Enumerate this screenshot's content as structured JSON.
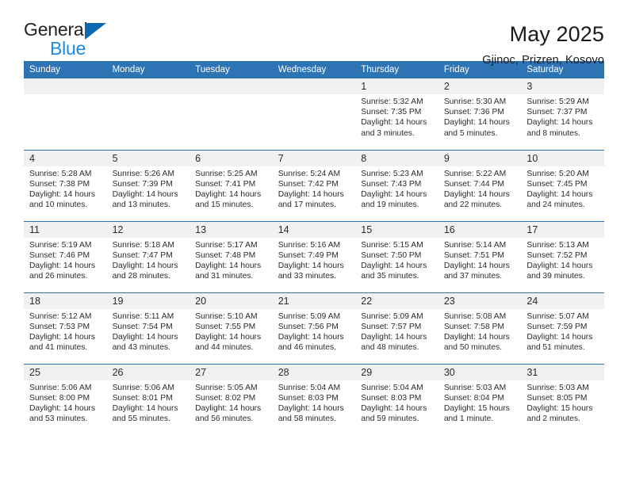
{
  "logo": {
    "word_top": "General",
    "word_bottom": "Blue",
    "triangle_color": "#0b68b1",
    "blue_text_color": "#1f8ae0"
  },
  "header": {
    "title": "May 2025",
    "subtitle": "Gjinoc, Prizren, Kosovo"
  },
  "theme": {
    "header_blue": "#2e74b5",
    "daynum_band": "#f1f1f1",
    "text": "#2b2b2b"
  },
  "calendar": {
    "weekday_headers": [
      "Sunday",
      "Monday",
      "Tuesday",
      "Wednesday",
      "Thursday",
      "Friday",
      "Saturday"
    ],
    "labels": {
      "sunrise": "Sunrise:",
      "sunset": "Sunset:",
      "daylight": "Daylight:"
    },
    "weeks": [
      [
        {
          "day": "",
          "lines": []
        },
        {
          "day": "",
          "lines": []
        },
        {
          "day": "",
          "lines": []
        },
        {
          "day": "",
          "lines": []
        },
        {
          "day": "1",
          "lines": [
            "Sunrise: 5:32 AM",
            "Sunset: 7:35 PM",
            "Daylight: 14 hours and 3 minutes."
          ]
        },
        {
          "day": "2",
          "lines": [
            "Sunrise: 5:30 AM",
            "Sunset: 7:36 PM",
            "Daylight: 14 hours and 5 minutes."
          ]
        },
        {
          "day": "3",
          "lines": [
            "Sunrise: 5:29 AM",
            "Sunset: 7:37 PM",
            "Daylight: 14 hours and 8 minutes."
          ]
        }
      ],
      [
        {
          "day": "4",
          "lines": [
            "Sunrise: 5:28 AM",
            "Sunset: 7:38 PM",
            "Daylight: 14 hours and 10 minutes."
          ]
        },
        {
          "day": "5",
          "lines": [
            "Sunrise: 5:26 AM",
            "Sunset: 7:39 PM",
            "Daylight: 14 hours and 13 minutes."
          ]
        },
        {
          "day": "6",
          "lines": [
            "Sunrise: 5:25 AM",
            "Sunset: 7:41 PM",
            "Daylight: 14 hours and 15 minutes."
          ]
        },
        {
          "day": "7",
          "lines": [
            "Sunrise: 5:24 AM",
            "Sunset: 7:42 PM",
            "Daylight: 14 hours and 17 minutes."
          ]
        },
        {
          "day": "8",
          "lines": [
            "Sunrise: 5:23 AM",
            "Sunset: 7:43 PM",
            "Daylight: 14 hours and 19 minutes."
          ]
        },
        {
          "day": "9",
          "lines": [
            "Sunrise: 5:22 AM",
            "Sunset: 7:44 PM",
            "Daylight: 14 hours and 22 minutes."
          ]
        },
        {
          "day": "10",
          "lines": [
            "Sunrise: 5:20 AM",
            "Sunset: 7:45 PM",
            "Daylight: 14 hours and 24 minutes."
          ]
        }
      ],
      [
        {
          "day": "11",
          "lines": [
            "Sunrise: 5:19 AM",
            "Sunset: 7:46 PM",
            "Daylight: 14 hours and 26 minutes."
          ]
        },
        {
          "day": "12",
          "lines": [
            "Sunrise: 5:18 AM",
            "Sunset: 7:47 PM",
            "Daylight: 14 hours and 28 minutes."
          ]
        },
        {
          "day": "13",
          "lines": [
            "Sunrise: 5:17 AM",
            "Sunset: 7:48 PM",
            "Daylight: 14 hours and 31 minutes."
          ]
        },
        {
          "day": "14",
          "lines": [
            "Sunrise: 5:16 AM",
            "Sunset: 7:49 PM",
            "Daylight: 14 hours and 33 minutes."
          ]
        },
        {
          "day": "15",
          "lines": [
            "Sunrise: 5:15 AM",
            "Sunset: 7:50 PM",
            "Daylight: 14 hours and 35 minutes."
          ]
        },
        {
          "day": "16",
          "lines": [
            "Sunrise: 5:14 AM",
            "Sunset: 7:51 PM",
            "Daylight: 14 hours and 37 minutes."
          ]
        },
        {
          "day": "17",
          "lines": [
            "Sunrise: 5:13 AM",
            "Sunset: 7:52 PM",
            "Daylight: 14 hours and 39 minutes."
          ]
        }
      ],
      [
        {
          "day": "18",
          "lines": [
            "Sunrise: 5:12 AM",
            "Sunset: 7:53 PM",
            "Daylight: 14 hours and 41 minutes."
          ]
        },
        {
          "day": "19",
          "lines": [
            "Sunrise: 5:11 AM",
            "Sunset: 7:54 PM",
            "Daylight: 14 hours and 43 minutes."
          ]
        },
        {
          "day": "20",
          "lines": [
            "Sunrise: 5:10 AM",
            "Sunset: 7:55 PM",
            "Daylight: 14 hours and 44 minutes."
          ]
        },
        {
          "day": "21",
          "lines": [
            "Sunrise: 5:09 AM",
            "Sunset: 7:56 PM",
            "Daylight: 14 hours and 46 minutes."
          ]
        },
        {
          "day": "22",
          "lines": [
            "Sunrise: 5:09 AM",
            "Sunset: 7:57 PM",
            "Daylight: 14 hours and 48 minutes."
          ]
        },
        {
          "day": "23",
          "lines": [
            "Sunrise: 5:08 AM",
            "Sunset: 7:58 PM",
            "Daylight: 14 hours and 50 minutes."
          ]
        },
        {
          "day": "24",
          "lines": [
            "Sunrise: 5:07 AM",
            "Sunset: 7:59 PM",
            "Daylight: 14 hours and 51 minutes."
          ]
        }
      ],
      [
        {
          "day": "25",
          "lines": [
            "Sunrise: 5:06 AM",
            "Sunset: 8:00 PM",
            "Daylight: 14 hours and 53 minutes."
          ]
        },
        {
          "day": "26",
          "lines": [
            "Sunrise: 5:06 AM",
            "Sunset: 8:01 PM",
            "Daylight: 14 hours and 55 minutes."
          ]
        },
        {
          "day": "27",
          "lines": [
            "Sunrise: 5:05 AM",
            "Sunset: 8:02 PM",
            "Daylight: 14 hours and 56 minutes."
          ]
        },
        {
          "day": "28",
          "lines": [
            "Sunrise: 5:04 AM",
            "Sunset: 8:03 PM",
            "Daylight: 14 hours and 58 minutes."
          ]
        },
        {
          "day": "29",
          "lines": [
            "Sunrise: 5:04 AM",
            "Sunset: 8:03 PM",
            "Daylight: 14 hours and 59 minutes."
          ]
        },
        {
          "day": "30",
          "lines": [
            "Sunrise: 5:03 AM",
            "Sunset: 8:04 PM",
            "Daylight: 15 hours and 1 minute."
          ]
        },
        {
          "day": "31",
          "lines": [
            "Sunrise: 5:03 AM",
            "Sunset: 8:05 PM",
            "Daylight: 15 hours and 2 minutes."
          ]
        }
      ]
    ]
  }
}
